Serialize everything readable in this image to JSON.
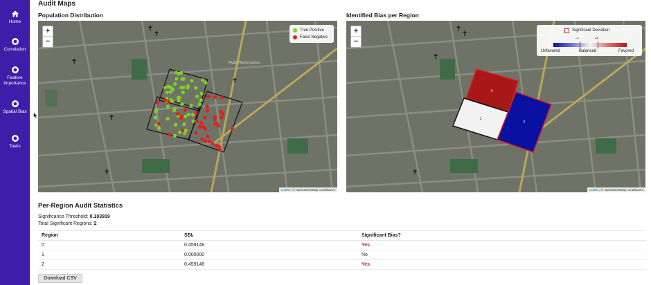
{
  "sidebar": {
    "items": [
      {
        "label": "Home",
        "icon": "home-icon"
      },
      {
        "label": "Correlation",
        "icon": "correlation-icon"
      },
      {
        "label": "Feature Importance",
        "icon": "feature-importance-icon"
      },
      {
        "label": "Spatial Bias",
        "icon": "spatial-bias-icon"
      },
      {
        "label": "Tasks",
        "icon": "tasks-icon"
      }
    ]
  },
  "header": {
    "title": "Audit Maps"
  },
  "maps": {
    "left": {
      "title": "Population Distribution",
      "legend": [
        {
          "label": "True Positive",
          "color": "#7ed321"
        },
        {
          "label": "False Negative",
          "color": "#e02020"
        }
      ]
    },
    "right": {
      "title": "Identified Bias per Region",
      "legend": {
        "significant_label": "Significant Deviation",
        "minus_tau": "−τ",
        "plus_tau": "+τ",
        "unfavored": "Unfavored",
        "balanced": "Balanced",
        "favored": "Favored"
      },
      "regions": [
        {
          "id": "0",
          "color": "#a81818"
        },
        {
          "id": "1",
          "color": "#f2f2f2"
        },
        {
          "id": "2",
          "color": "#0a10a0"
        }
      ]
    },
    "zoom_in": "+",
    "zoom_out": "−",
    "attribution": {
      "leaflet": "Leaflet",
      "rest": "| © OpenStreetMap contributors"
    },
    "street_label": "Αλέξη Παπαστρατου"
  },
  "stats": {
    "title": "Per-Region Audit Statistics",
    "threshold_label": "Significance Threshold:",
    "threshold_value": "0.103919",
    "total_label": "Total Significant Regions:",
    "total_value": "2",
    "columns": [
      "Region",
      "SBIᵣ",
      "Significant Bias?"
    ],
    "rows": [
      {
        "region": "0",
        "sbi": "0.459148",
        "significant": "Yes"
      },
      {
        "region": "1",
        "sbi": "0.000000",
        "significant": "No"
      },
      {
        "region": "2",
        "sbi": "0.459148",
        "significant": "Yes"
      }
    ],
    "download_label": "Download CSV"
  },
  "colors": {
    "sidebar": "#3e1ea8",
    "true_positive": "#7ed321",
    "false_negative": "#e02020",
    "yes": "#d62020"
  }
}
